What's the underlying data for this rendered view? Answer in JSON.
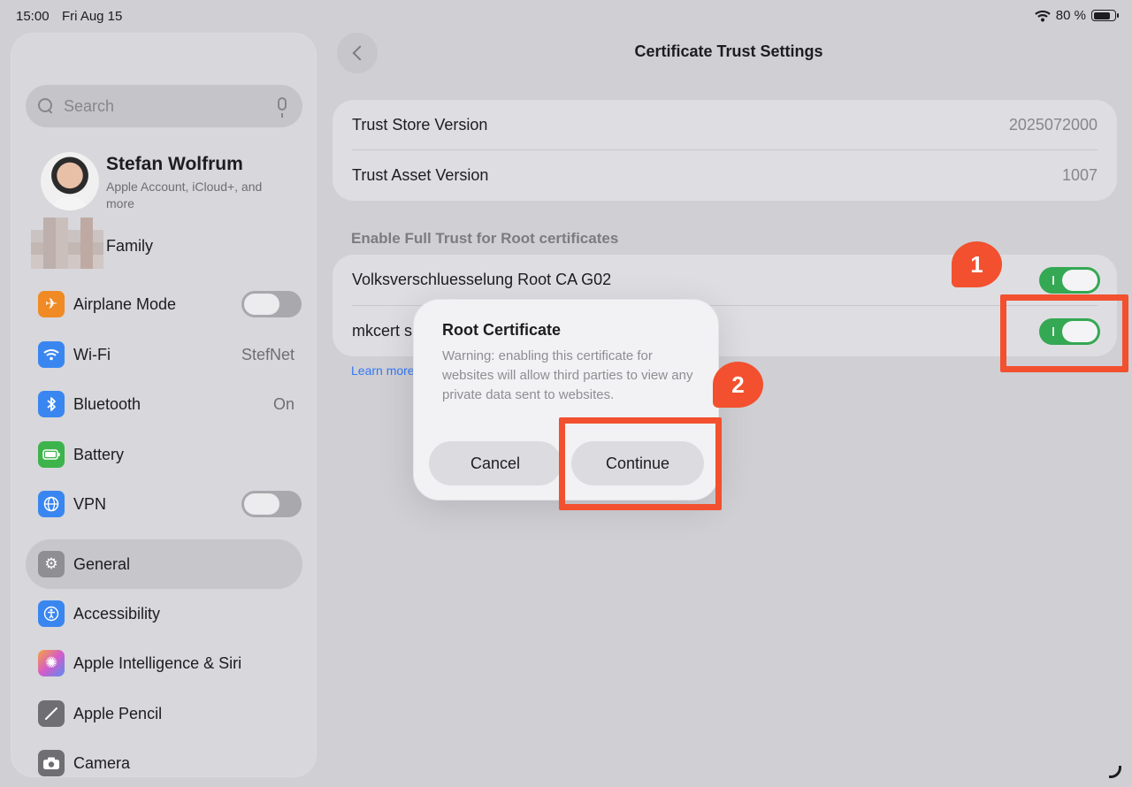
{
  "status_bar": {
    "time": "15:00",
    "date": "Fri Aug 15",
    "battery": "80 %"
  },
  "sidebar": {
    "search_placeholder": "Search",
    "profile": {
      "name": "Stefan Wolfrum",
      "subtitle": "Apple Account, iCloud+, and more"
    },
    "family_label": "Family",
    "items": [
      {
        "label": "Airplane Mode",
        "value": "",
        "toggle": "off",
        "icon": "airplane-icon",
        "color": "#f08a24"
      },
      {
        "label": "Wi-Fi",
        "value": "StefNet",
        "icon": "wifi-icon",
        "color": "#3a86f0"
      },
      {
        "label": "Bluetooth",
        "value": "On",
        "icon": "bluetooth-icon",
        "color": "#3a86f0"
      },
      {
        "label": "Battery",
        "value": "",
        "icon": "battery-icon",
        "color": "#3cb44b"
      },
      {
        "label": "VPN",
        "value": "",
        "toggle": "off",
        "icon": "globe-icon",
        "color": "#3a86f0"
      },
      {
        "label": "General",
        "value": "",
        "icon": "gear-icon",
        "color": "#8e8e93",
        "selected": true
      },
      {
        "label": "Accessibility",
        "value": "",
        "icon": "accessibility-icon",
        "color": "#3a86f0"
      },
      {
        "label": "Apple Intelligence & Siri",
        "value": "",
        "icon": "siri-icon",
        "color": "#c95fd8"
      },
      {
        "label": "Apple Pencil",
        "value": "",
        "icon": "pencil-icon",
        "color": "#6e6e73"
      },
      {
        "label": "Camera",
        "value": "",
        "icon": "camera-icon",
        "color": "#6e6e73"
      }
    ]
  },
  "main": {
    "title": "Certificate Trust Settings",
    "versions": [
      {
        "label": "Trust Store Version",
        "value": "2025072000"
      },
      {
        "label": "Trust Asset Version",
        "value": "1007"
      }
    ],
    "section_header": "Enable Full Trust for Root certificates",
    "certificates": [
      {
        "label": "Volksverschluesselung Root CA G02",
        "enabled": true
      },
      {
        "label": "mkcert s",
        "enabled": true
      }
    ],
    "learn_more": "Learn more"
  },
  "alert": {
    "title": "Root Certificate",
    "message": "Warning: enabling this certificate for websites will allow third parties to view any private data sent to websites.",
    "cancel_label": "Cancel",
    "continue_label": "Continue"
  },
  "annotations": {
    "badge_1": "1",
    "badge_2": "2",
    "color": "#f2502e"
  }
}
